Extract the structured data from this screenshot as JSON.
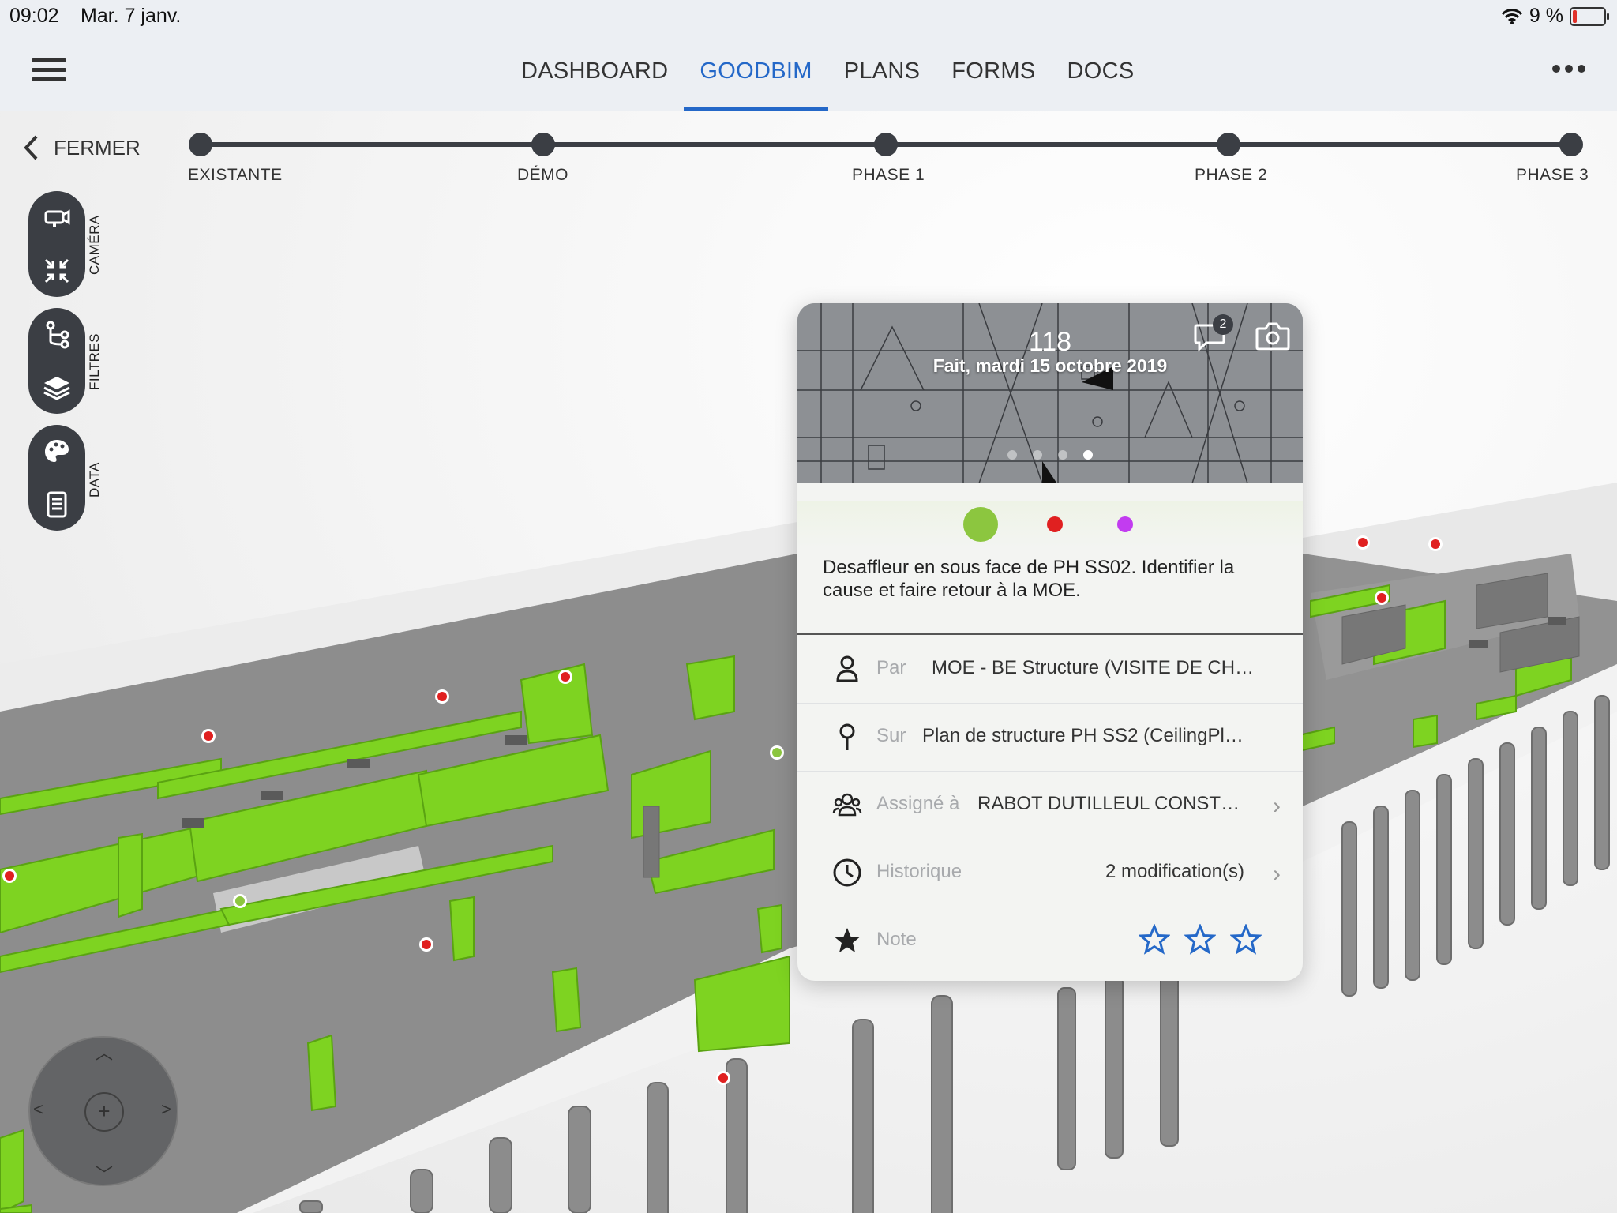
{
  "status_bar": {
    "time": "09:02",
    "date": "Mar. 7 janv.",
    "battery": "9 %",
    "icons": [
      "wifi-icon",
      "battery-low-icon"
    ]
  },
  "nav": {
    "tabs": [
      {
        "label": "DASHBOARD",
        "active": false
      },
      {
        "label": "GOODBIM",
        "active": true
      },
      {
        "label": "PLANS",
        "active": false
      },
      {
        "label": "FORMS",
        "active": false
      },
      {
        "label": "DOCS",
        "active": false
      }
    ],
    "accent": "#2468c8"
  },
  "timeline": {
    "close_label": "FERMER",
    "phases": [
      "EXISTANTE",
      "DÉMO",
      "PHASE 1",
      "PHASE 2",
      "PHASE 3"
    ]
  },
  "side_tools": {
    "camera": {
      "label": "CAMÉRA",
      "icons": [
        "video-camera-icon",
        "collapse-arrows-icon"
      ]
    },
    "filters": {
      "label": "FILTRES",
      "icons": [
        "branch-filter-icon",
        "layers-icon"
      ]
    },
    "data": {
      "label": "DATA",
      "icons": [
        "palette-icon",
        "document-icon"
      ]
    }
  },
  "card": {
    "number": "118",
    "status_line": "Fait, mardi 15 octobre 2019",
    "comments_count": "2",
    "status_colors": [
      "#8cc63f",
      "#e02020",
      "#c23cf0"
    ],
    "description": "Desaffleur en sous face de PH SS02. Identifier la cause et faire  retour à la MOE.",
    "rows": [
      {
        "icon": "person-icon",
        "label": "Par",
        "value": "MOE - BE Structure (VISITE DE CH…"
      },
      {
        "icon": "pin-icon",
        "label": "Sur",
        "value": "Plan de structure PH SS2 (CeilingPl…"
      },
      {
        "icon": "group-icon",
        "label": "Assigné à",
        "value": "RABOT DUTILLEUL CONST…"
      },
      {
        "icon": "clock-icon",
        "label": "Historique",
        "value": "2 modification(s)"
      },
      {
        "icon": "star-icon",
        "label": "Note",
        "value": ""
      }
    ],
    "rating": {
      "value": 0,
      "max": 3
    }
  }
}
